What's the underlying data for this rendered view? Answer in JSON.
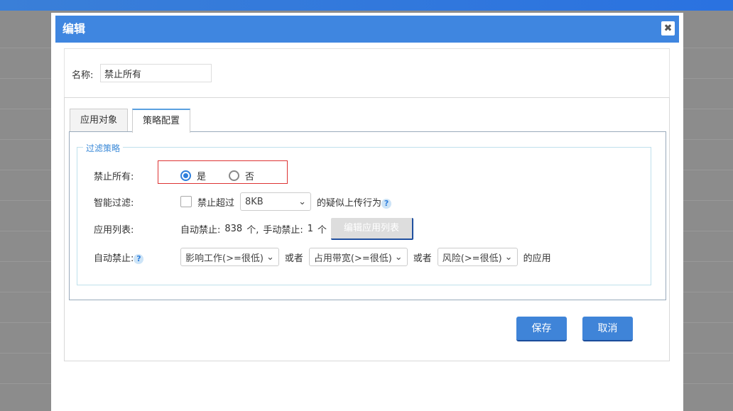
{
  "dialog": {
    "title": "编辑",
    "close_icon": "✖"
  },
  "name": {
    "label": "名称:",
    "value": "禁止所有"
  },
  "tabs": [
    {
      "label": "应用对象"
    },
    {
      "label": "策略配置"
    }
  ],
  "filter": {
    "legend": "过滤策略",
    "block_all": {
      "label": "禁止所有:",
      "yes": "是",
      "no": "否",
      "selected": "是"
    },
    "smart": {
      "label": "智能过滤:",
      "checkbox_text": "禁止超过",
      "size": "8KB",
      "suffix": "的疑似上传行为",
      "checked": false
    },
    "app_list": {
      "label": "应用列表:",
      "auto_label": "自动禁止:",
      "auto_count": "838",
      "unit": "个,",
      "manual_label": "手动禁止:",
      "manual_count": "1",
      "unit2": "个",
      "edit_button": "编辑应用列表"
    },
    "auto_block": {
      "label": "自动禁止:",
      "impact": "影响工作(>=很低)",
      "or1": "或者",
      "bandwidth": "占用带宽(>=很低)",
      "or2": "或者",
      "risk": "风险(>=很低)",
      "suffix": "的应用"
    }
  },
  "buttons": {
    "save": "保存",
    "cancel": "取消"
  },
  "help_icon": "?"
}
